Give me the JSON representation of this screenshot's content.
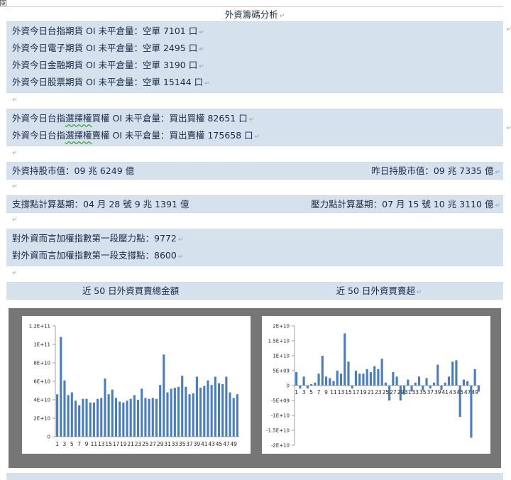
{
  "title": "外資籌碼分析",
  "futures_oi": [
    "外資今日台指期貨 OI 未平倉量：空單 7101 口",
    "外資今日電子期貨 OI 未平倉量：空單 2495 口",
    "外資今日金融期貨 OI 未平倉量：空單 3190 口",
    "外資今日股票期貨 OI 未平倉量：空單 15144 口"
  ],
  "options_oi": {
    "call": {
      "pre": "外資今日台指",
      "wavy": "選擇權",
      "post": "買權 OI 未平倉量：買出買權 82651 口"
    },
    "put": {
      "pre": "外資今日台指",
      "wavy": "選擇權",
      "post": "賣權 OI 未平倉量：買出賣權 175658 口"
    }
  },
  "market_value": {
    "today": "外資持股市值：09 兆 6249 億",
    "yesterday": "昨日持股市值：09 兆 7335 億"
  },
  "base_period": {
    "support": "支撐點計算基期：04 月 28 號 9 兆 1391 億",
    "pressure": "壓力點計算基期：07 月 15 號 10 兆 3110 億"
  },
  "index_levels": [
    "對外資而言加權指數第一段壓力點：9772",
    "對外資而言加權指數第一段支撐點：8600"
  ],
  "chart_headers": {
    "left": "近 50 日外資買賣總金額",
    "right": "近 50 日外資買賣超"
  },
  "paragraph_mark": "↵",
  "move_handle": "⊕",
  "chart_data": [
    {
      "type": "bar",
      "title": "",
      "color": "#4a7ebb",
      "ylim": [
        0,
        120000000000
      ],
      "yticks": [
        0,
        20000000000,
        40000000000,
        60000000000,
        80000000000,
        100000000000,
        120000000000
      ],
      "ytick_labels": [
        "0",
        "2E+10",
        "4E+10",
        "6E+10",
        "8E+10",
        "1E+11",
        "1.2E+11"
      ],
      "categories": [
        1,
        2,
        3,
        4,
        5,
        6,
        7,
        8,
        9,
        10,
        11,
        12,
        13,
        14,
        15,
        16,
        17,
        18,
        19,
        20,
        21,
        22,
        23,
        24,
        25,
        26,
        27,
        28,
        29,
        30,
        31,
        32,
        33,
        34,
        35,
        36,
        37,
        38,
        39,
        40,
        41,
        42,
        43,
        44,
        45,
        46,
        47,
        48,
        49,
        50
      ],
      "xtick_labels": [
        "1",
        "3",
        "5",
        "7",
        "9",
        "11",
        "13",
        "15",
        "17",
        "19",
        "21",
        "23",
        "25",
        "27",
        "29",
        "31",
        "33",
        "35",
        "37",
        "39",
        "41",
        "43",
        "45",
        "47",
        "49"
      ],
      "values": [
        46000000000,
        108000000000,
        61000000000,
        45000000000,
        48000000000,
        39000000000,
        34000000000,
        41000000000,
        41000000000,
        37000000000,
        37000000000,
        41000000000,
        42000000000,
        63000000000,
        46000000000,
        51000000000,
        42000000000,
        38000000000,
        37000000000,
        39000000000,
        41000000000,
        45000000000,
        40000000000,
        52000000000,
        42000000000,
        41000000000,
        42000000000,
        41000000000,
        56000000000,
        89000000000,
        48000000000,
        52000000000,
        53000000000,
        54000000000,
        66000000000,
        54000000000,
        46000000000,
        47000000000,
        65000000000,
        53000000000,
        55000000000,
        61000000000,
        56000000000,
        65000000000,
        58000000000,
        57000000000,
        65000000000,
        48000000000,
        42000000000,
        46000000000
      ]
    },
    {
      "type": "bar",
      "title": "",
      "color": "#4a7ebb",
      "ylim": [
        -20000000000,
        20000000000
      ],
      "yticks": [
        -20000000000,
        -15000000000,
        -10000000000,
        -5000000000,
        0,
        5000000000,
        10000000000,
        15000000000,
        20000000000
      ],
      "ytick_labels": [
        "-2E+10",
        "-1.5E+10",
        "-1E+10",
        "-5E+09",
        "0",
        "5E+09",
        "1E+10",
        "1.5E+10",
        "2E+10"
      ],
      "categories": [
        1,
        2,
        3,
        4,
        5,
        6,
        7,
        8,
        9,
        10,
        11,
        12,
        13,
        14,
        15,
        16,
        17,
        18,
        19,
        20,
        21,
        22,
        23,
        24,
        25,
        26,
        27,
        28,
        29,
        30,
        31,
        32,
        33,
        34,
        35,
        36,
        37,
        38,
        39,
        40,
        41,
        42,
        43,
        44,
        45,
        46,
        47,
        48,
        49,
        50
      ],
      "xtick_labels": [
        "1",
        "3",
        "5",
        "7",
        "9",
        "11",
        "13",
        "15",
        "17",
        "19",
        "21",
        "23",
        "25",
        "27",
        "29",
        "31",
        "33",
        "35",
        "37",
        "39",
        "41",
        "43",
        "45",
        "47",
        "49"
      ],
      "values": [
        4500000000,
        -1000000000,
        3000000000,
        -1000000000,
        500000000,
        1000000000,
        4000000000,
        10000000000,
        3000000000,
        2500000000,
        1500000000,
        5000000000,
        4000000000,
        17500000000,
        8000000000,
        -1000000000,
        5000000000,
        4000000000,
        4000000000,
        5500000000,
        4500000000,
        6500000000,
        5500000000,
        9000000000,
        1000000000,
        -5000000000,
        4500000000,
        3000000000,
        -5000000000,
        -3000000000,
        2000000000,
        -2000000000,
        1000000000,
        3000000000,
        -1500000000,
        2500000000,
        -1000000000,
        1000000000,
        7000000000,
        -1500000000,
        1000000000,
        3000000000,
        8000000000,
        8500000000,
        -10500000000,
        2000000000,
        1500000000,
        -17500000000,
        5500000000,
        -2000000000
      ]
    }
  ]
}
